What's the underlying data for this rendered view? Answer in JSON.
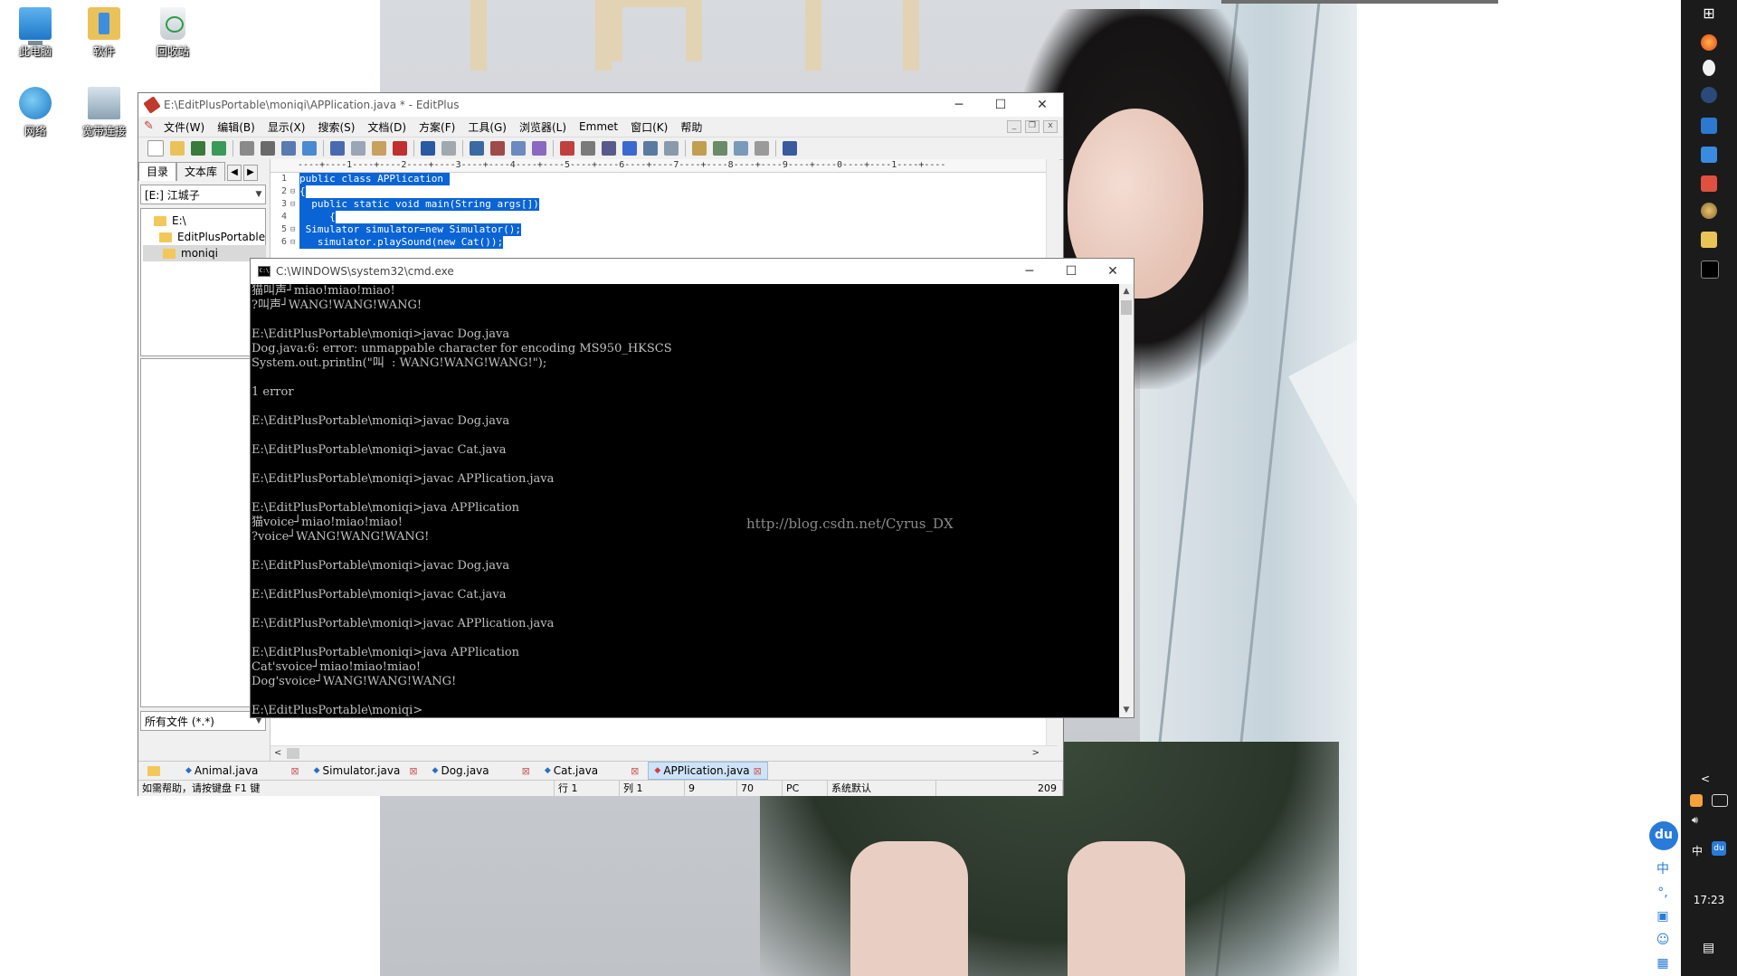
{
  "desktop": {
    "icons": [
      {
        "label": "此电脑",
        "name": "this-pc"
      },
      {
        "label": "软件",
        "name": "software"
      },
      {
        "label": "回收站",
        "name": "recycle-bin"
      },
      {
        "label": "网络",
        "name": "network"
      },
      {
        "label": "宽带连接",
        "name": "broadband"
      }
    ]
  },
  "editplus": {
    "title": "E:\\EditPlusPortable\\moniqi\\APPlication.java * - EditPlus",
    "menu": [
      "文件(W)",
      "编辑(B)",
      "显示(X)",
      "搜索(S)",
      "文档(D)",
      "方案(F)",
      "工具(G)",
      "浏览器(L)",
      "Emmet",
      "窗口(K)",
      "帮助"
    ],
    "left_tabs": [
      "目录",
      "文本库"
    ],
    "drive": "[E:] 江城子",
    "tree": [
      "E:\\",
      "EditPlusPortable",
      "moniqi"
    ],
    "filter": "所有文件 (*.*)",
    "ruler": "----+----1----+----2----+----3----+----4----+----5----+----6----+----7----+----8----+----9----+----0----+----1----+----",
    "code": [
      {
        "n": "1",
        "fold": "",
        "text": "public class APPlication "
      },
      {
        "n": "2",
        "fold": "⊟",
        "text": "{"
      },
      {
        "n": "3",
        "fold": "⊟",
        "text": "  public static void main(String args[])"
      },
      {
        "n": "4",
        "fold": "",
        "text": "     {"
      },
      {
        "n": "5",
        "fold": "⊟",
        "text": " Simulator simulator=new Simulator();"
      },
      {
        "n": "6",
        "fold": "⊟",
        "text": "   simulator.playSound(new Cat());"
      }
    ],
    "doc_tabs": [
      "Animal.java",
      "Simulator.java",
      "Dog.java",
      "Cat.java",
      "APPlication.java"
    ],
    "active_doc": "APPlication.java",
    "status": {
      "help": "如需帮助，请按键盘 F1 键",
      "row": "行 1",
      "col": "列 1",
      "v1": "9",
      "v2": "70",
      "mode": "PC",
      "encoding": "系统默认",
      "size": "209"
    }
  },
  "cmd": {
    "title": "C:\\WINDOWS\\system32\\cmd.exe",
    "output": "猫叫声┘miao!miao!miao!\n?叫声┘WANG!WANG!WANG!\n\nE:\\EditPlusPortable\\moniqi>javac Dog.java\nDog.java:6: error: unmappable character for encoding MS950_HKSCS\nSystem.out.println(\"叫  : WANG!WANG!WANG!\");\n\n1 error\n\nE:\\EditPlusPortable\\moniqi>javac Dog.java\n\nE:\\EditPlusPortable\\moniqi>javac Cat.java\n\nE:\\EditPlusPortable\\moniqi>javac APPlication.java\n\nE:\\EditPlusPortable\\moniqi>java APPlication\n猫voice┘miao!miao!miao!\n?voice┘WANG!WANG!WANG!\n\nE:\\EditPlusPortable\\moniqi>javac Dog.java\n\nE:\\EditPlusPortable\\moniqi>javac Cat.java\n\nE:\\EditPlusPortable\\moniqi>javac APPlication.java\n\nE:\\EditPlusPortable\\moniqi>java APPlication\nCat'svoice┘miao!miao!miao!\nDog'svoice┘WANG!WANG!WANG!\n\nE:\\EditPlusPortable\\moniqi>",
    "watermark": "http://blog.csdn.net/Cyrus_DX"
  },
  "taskbar": {
    "ime_lang": "中",
    "time": "17:23",
    "du_badge": "du",
    "side_tools": [
      "中",
      "°,"
    ]
  },
  "colors": {
    "selection": "#0a64d6",
    "console_bg": "#000000",
    "console_fg": "#c0c0c0",
    "taskbar": "#1b1b1b",
    "active_tab": "#cfe3f7"
  }
}
